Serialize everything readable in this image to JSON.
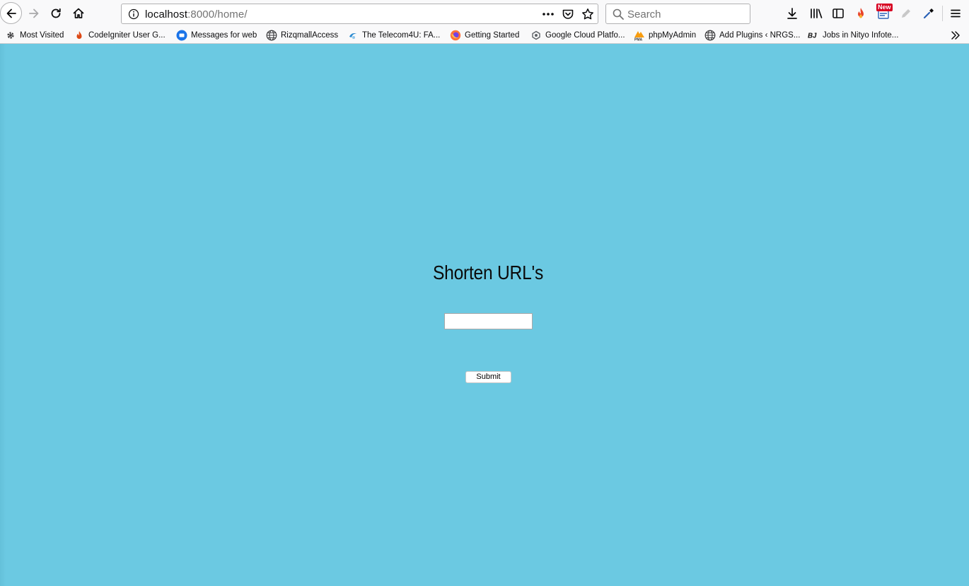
{
  "browser": {
    "url_host": "localhost",
    "url_rest": ":8000/home/",
    "search_placeholder": "Search",
    "new_badge": "New",
    "icons": {
      "back": "arrow-left-icon",
      "forward": "arrow-right-icon",
      "reload": "reload-icon",
      "home": "home-icon",
      "page_info": "info-icon",
      "page_actions": "more-horizontal-icon",
      "pocket": "pocket-icon",
      "bookmark_star": "star-icon",
      "search": "search-icon",
      "downloads": "download-icon",
      "library": "library-icon",
      "sidebar": "sidebar-icon",
      "extension1": "flame-icon",
      "extension2": "new-tab-icon",
      "extension3": "pencil-icon",
      "extension4": "eyedropper-icon",
      "menu": "hamburger-menu-icon",
      "overflow": "chevron-double-right-icon"
    }
  },
  "bookmarks": [
    {
      "label": "Most Visited",
      "icon": "gear-icon"
    },
    {
      "label": "CodeIgniter User G...",
      "icon": "flame-icon"
    },
    {
      "label": "Messages for web",
      "icon": "chat-icon"
    },
    {
      "label": "RizqmallAccess",
      "icon": "globe-icon"
    },
    {
      "label": "The Telecom4U: FA...",
      "icon": "telecom-icon"
    },
    {
      "label": "Getting Started",
      "icon": "firefox-icon"
    },
    {
      "label": "Google Cloud Platfo...",
      "icon": "cloud-icon"
    },
    {
      "label": "phpMyAdmin",
      "icon": "pma-icon"
    },
    {
      "label": "Add Plugins ‹ NRGS...",
      "icon": "globe-icon"
    },
    {
      "label": "Jobs in Nityo Infote...",
      "icon": "bj-icon"
    }
  ],
  "page": {
    "title": "Shorten URL's",
    "input_value": "",
    "submit_label": "Submit",
    "background_color": "#6bc9e2"
  }
}
